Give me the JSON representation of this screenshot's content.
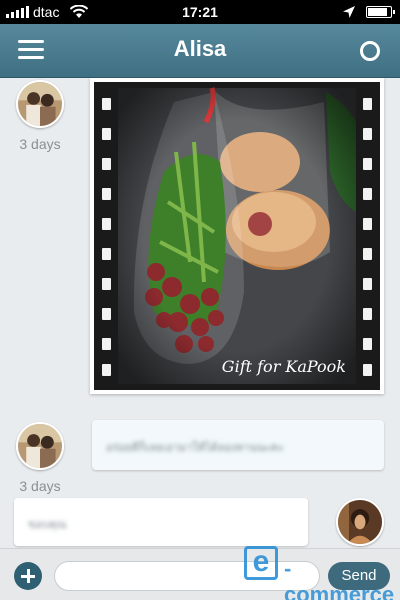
{
  "status_bar": {
    "carrier": "dtac",
    "time": "17:21",
    "battery_level": 0.85
  },
  "header": {
    "title": "Alisa",
    "menu_icon": "hamburger-menu-icon",
    "status_icon": "circle-status-icon"
  },
  "messages": [
    {
      "type": "photo",
      "direction": "in",
      "time": "3 days",
      "photo_caption": "Gift for KaPook"
    },
    {
      "type": "text",
      "direction": "in",
      "time": "3 days",
      "text": "อร่อยดีก็เลยเอามาให้ได้ลองทานนะคะ"
    },
    {
      "type": "text",
      "direction": "out",
      "text": "ขอบคุณ"
    }
  ],
  "composer": {
    "value": "",
    "placeholder": "",
    "send_label": "Send",
    "add_icon": "plus-circle-icon"
  },
  "watermark": {
    "letter": "e",
    "text": "-commerce"
  },
  "colors": {
    "header": "#4a7b8e",
    "background": "#e9ecee",
    "incoming_bubble": "#f2f8fb",
    "send_button": "#3e6a7d",
    "watermark": "#2c8fd6"
  }
}
